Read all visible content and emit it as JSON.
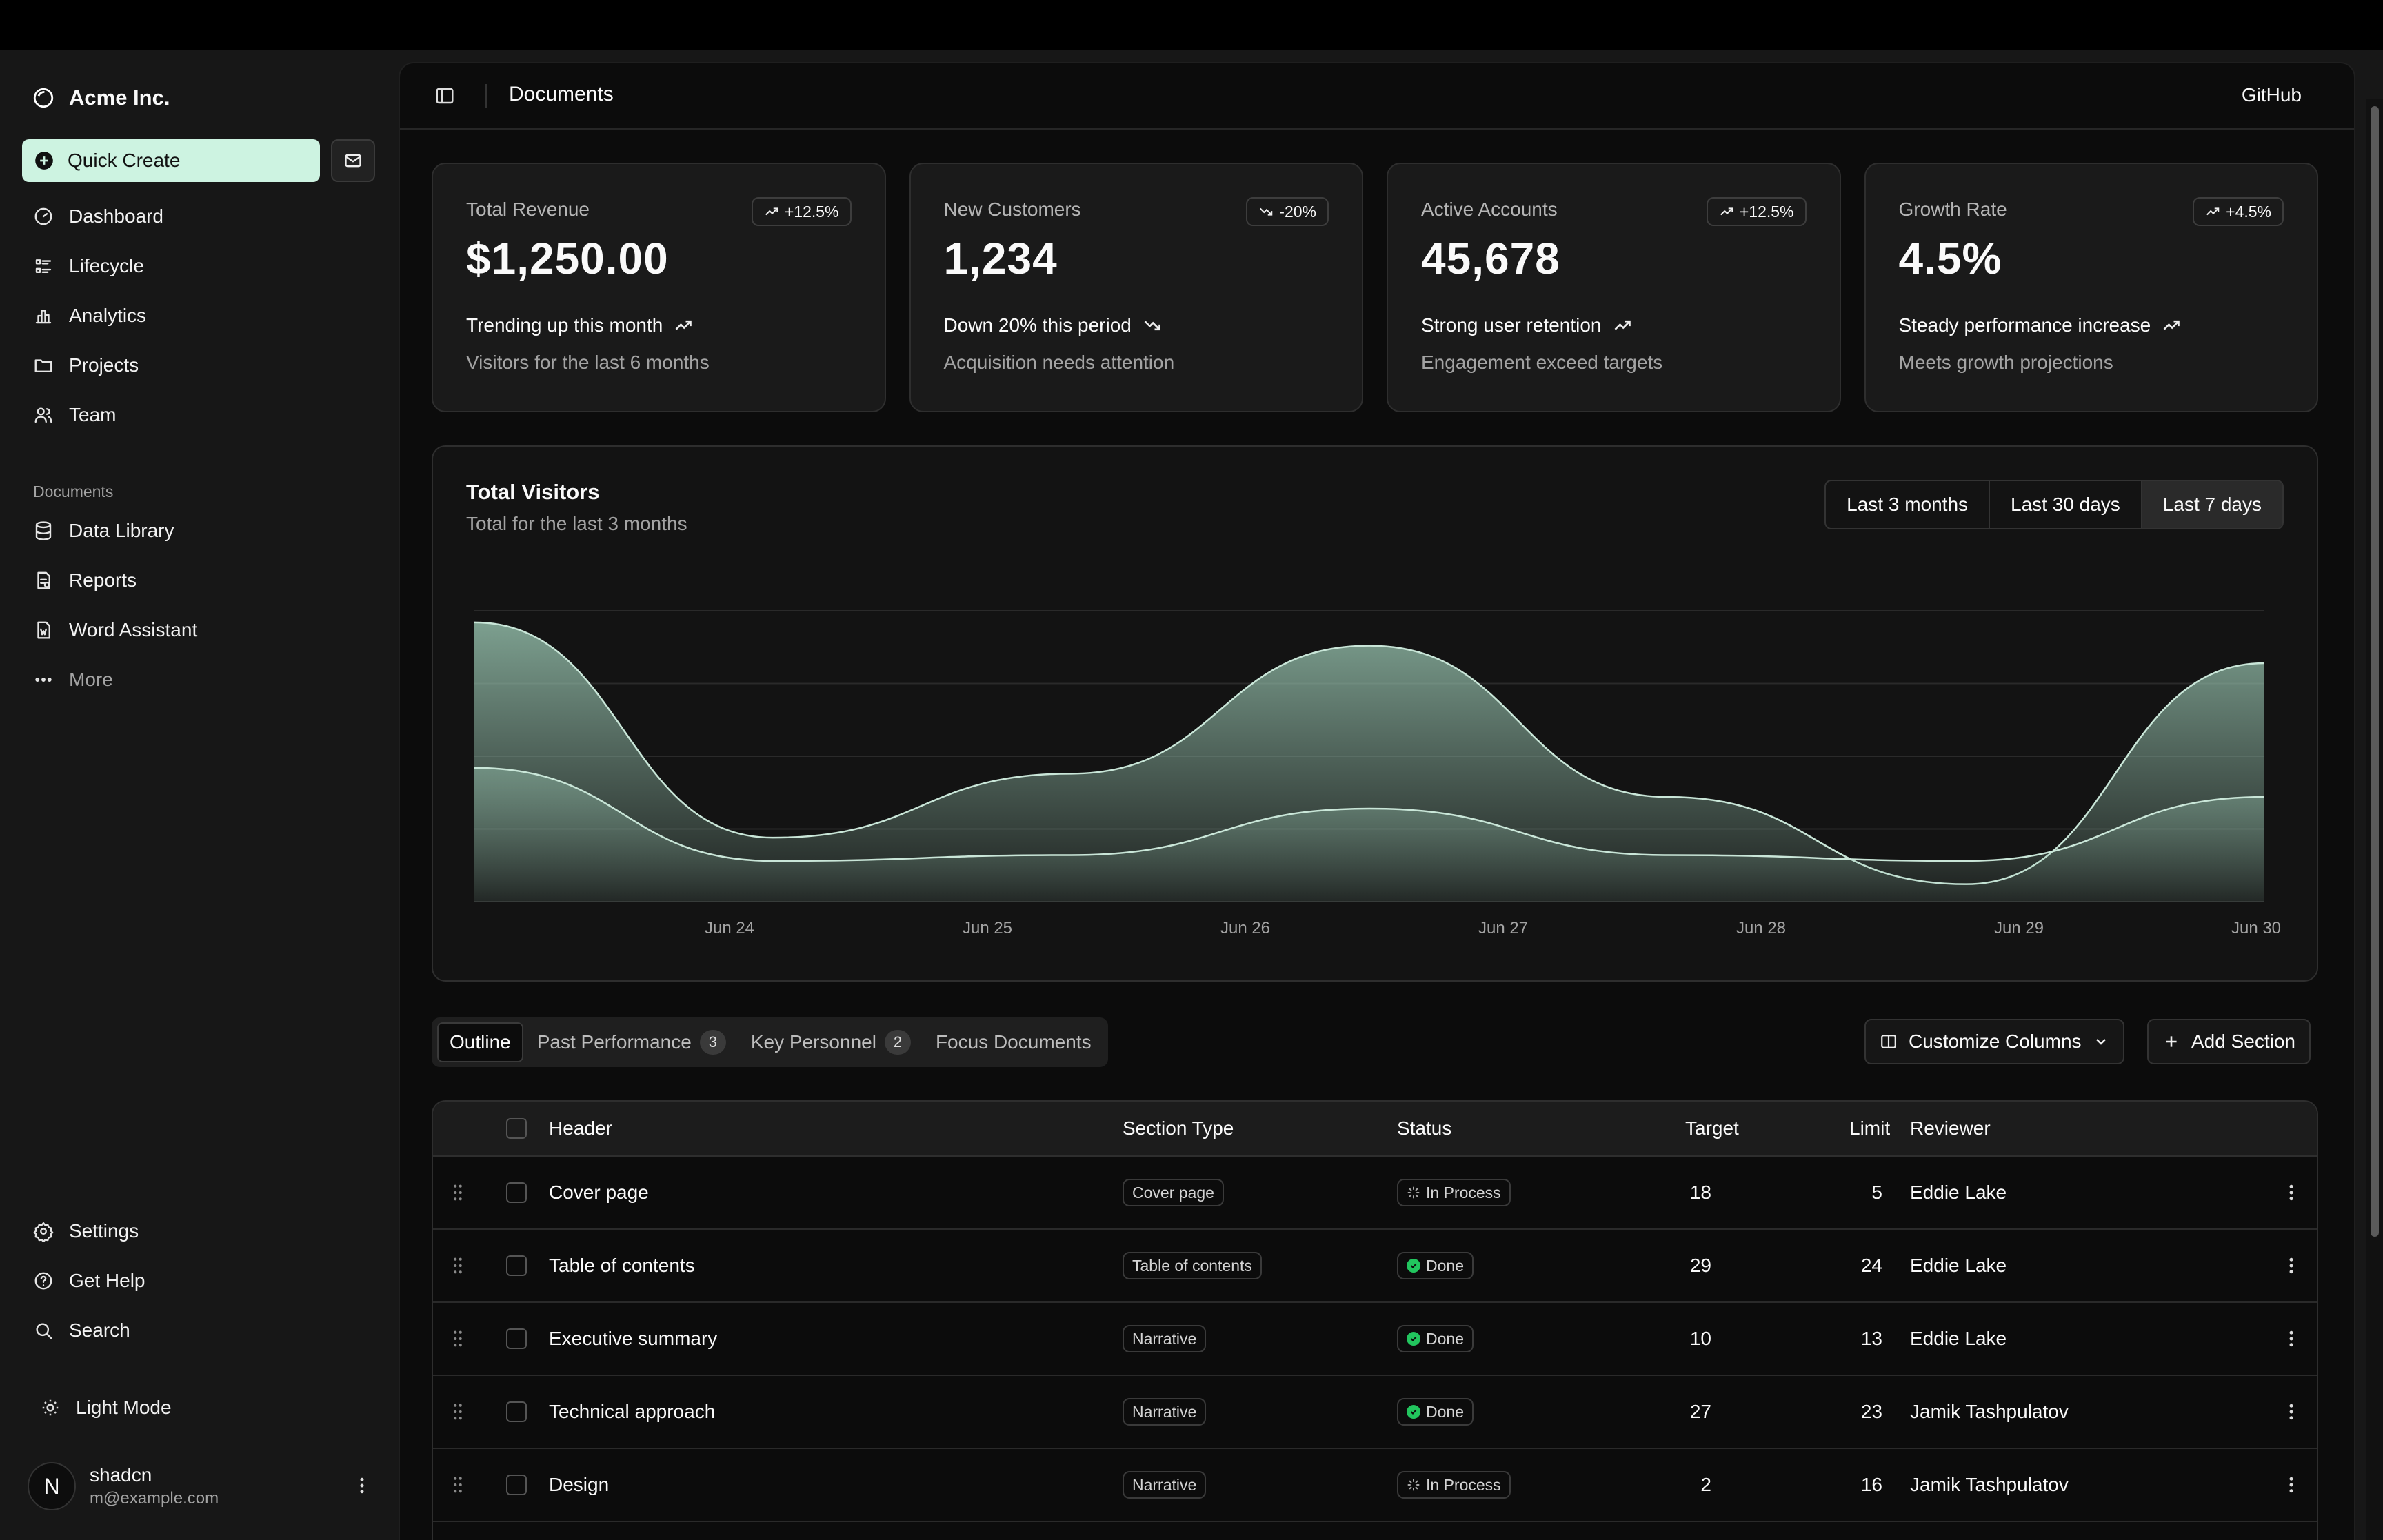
{
  "brand": {
    "name": "Acme Inc."
  },
  "sidebar": {
    "quick_create": "Quick Create",
    "main_nav": [
      {
        "label": "Dashboard",
        "icon": "gauge-icon"
      },
      {
        "label": "Lifecycle",
        "icon": "list-details-icon"
      },
      {
        "label": "Analytics",
        "icon": "chart-bar-icon"
      },
      {
        "label": "Projects",
        "icon": "folder-icon"
      },
      {
        "label": "Team",
        "icon": "users-icon"
      }
    ],
    "documents_label": "Documents",
    "documents_nav": [
      {
        "label": "Data Library",
        "icon": "database-icon"
      },
      {
        "label": "Reports",
        "icon": "report-icon"
      },
      {
        "label": "Word Assistant",
        "icon": "file-word-icon"
      },
      {
        "label": "More",
        "icon": "dots-icon"
      }
    ],
    "bottom_nav": [
      {
        "label": "Settings",
        "icon": "gear-icon"
      },
      {
        "label": "Get Help",
        "icon": "help-icon"
      },
      {
        "label": "Search",
        "icon": "search-icon"
      }
    ],
    "theme_toggle": "Light Mode",
    "user": {
      "initial": "N",
      "name": "shadcn",
      "email": "m@example.com"
    }
  },
  "header": {
    "title": "Documents",
    "github": "GitHub"
  },
  "cards": [
    {
      "label": "Total Revenue",
      "value": "$1,250.00",
      "badge": "+12.5%",
      "badge_dir": "up",
      "trend": "Trending up this month",
      "trend_dir": "up",
      "sub": "Visitors for the last 6 months"
    },
    {
      "label": "New Customers",
      "value": "1,234",
      "badge": "-20%",
      "badge_dir": "down",
      "trend": "Down 20% this period",
      "trend_dir": "down",
      "sub": "Acquisition needs attention"
    },
    {
      "label": "Active Accounts",
      "value": "45,678",
      "badge": "+12.5%",
      "badge_dir": "up",
      "trend": "Strong user retention",
      "trend_dir": "up",
      "sub": "Engagement exceed targets"
    },
    {
      "label": "Growth Rate",
      "value": "4.5%",
      "badge": "+4.5%",
      "badge_dir": "up",
      "trend": "Steady performance increase",
      "trend_dir": "up",
      "sub": "Meets growth projections"
    }
  ],
  "chart": {
    "title": "Total Visitors",
    "subtitle": "Total for the last 3 months",
    "ranges": [
      "Last 3 months",
      "Last 30 days",
      "Last 7 days"
    ],
    "active_range": "Last 7 days",
    "accent": "#8fb8a5"
  },
  "chart_data": {
    "type": "area",
    "x": [
      "Jun 24",
      "Jun 25",
      "Jun 26",
      "Jun 27",
      "Jun 28",
      "Jun 29",
      "Jun 30"
    ],
    "x_ticks": [
      "Jun 24",
      "Jun 25",
      "Jun 26",
      "Jun 27",
      "Jun 28",
      "Jun 29",
      "Jun 30"
    ],
    "series": [
      {
        "values": [
          240,
          55,
          110,
          220,
          90,
          15,
          205
        ]
      },
      {
        "values": [
          115,
          35,
          40,
          80,
          40,
          35,
          90
        ]
      }
    ],
    "ylim": [
      0,
      250
    ],
    "grid": true,
    "legend": "none"
  },
  "tabs": [
    {
      "label": "Outline",
      "count": ""
    },
    {
      "label": "Past Performance",
      "count": "3"
    },
    {
      "label": "Key Personnel",
      "count": "2"
    },
    {
      "label": "Focus Documents",
      "count": ""
    }
  ],
  "actions": {
    "customize": "Customize Columns",
    "add_section": "Add Section"
  },
  "table": {
    "columns": [
      "Header",
      "Section Type",
      "Status",
      "Target",
      "Limit",
      "Reviewer"
    ],
    "rows": [
      {
        "header": "Cover page",
        "type": "Cover page",
        "status": "In Process",
        "target": "18",
        "limit": "5",
        "reviewer": "Eddie Lake"
      },
      {
        "header": "Table of contents",
        "type": "Table of contents",
        "status": "Done",
        "target": "29",
        "limit": "24",
        "reviewer": "Eddie Lake"
      },
      {
        "header": "Executive summary",
        "type": "Narrative",
        "status": "Done",
        "target": "10",
        "limit": "13",
        "reviewer": "Eddie Lake"
      },
      {
        "header": "Technical approach",
        "type": "Narrative",
        "status": "Done",
        "target": "27",
        "limit": "23",
        "reviewer": "Jamik Tashpulatov"
      },
      {
        "header": "Design",
        "type": "Narrative",
        "status": "In Process",
        "target": "2",
        "limit": "16",
        "reviewer": "Jamik Tashpulatov"
      }
    ]
  }
}
